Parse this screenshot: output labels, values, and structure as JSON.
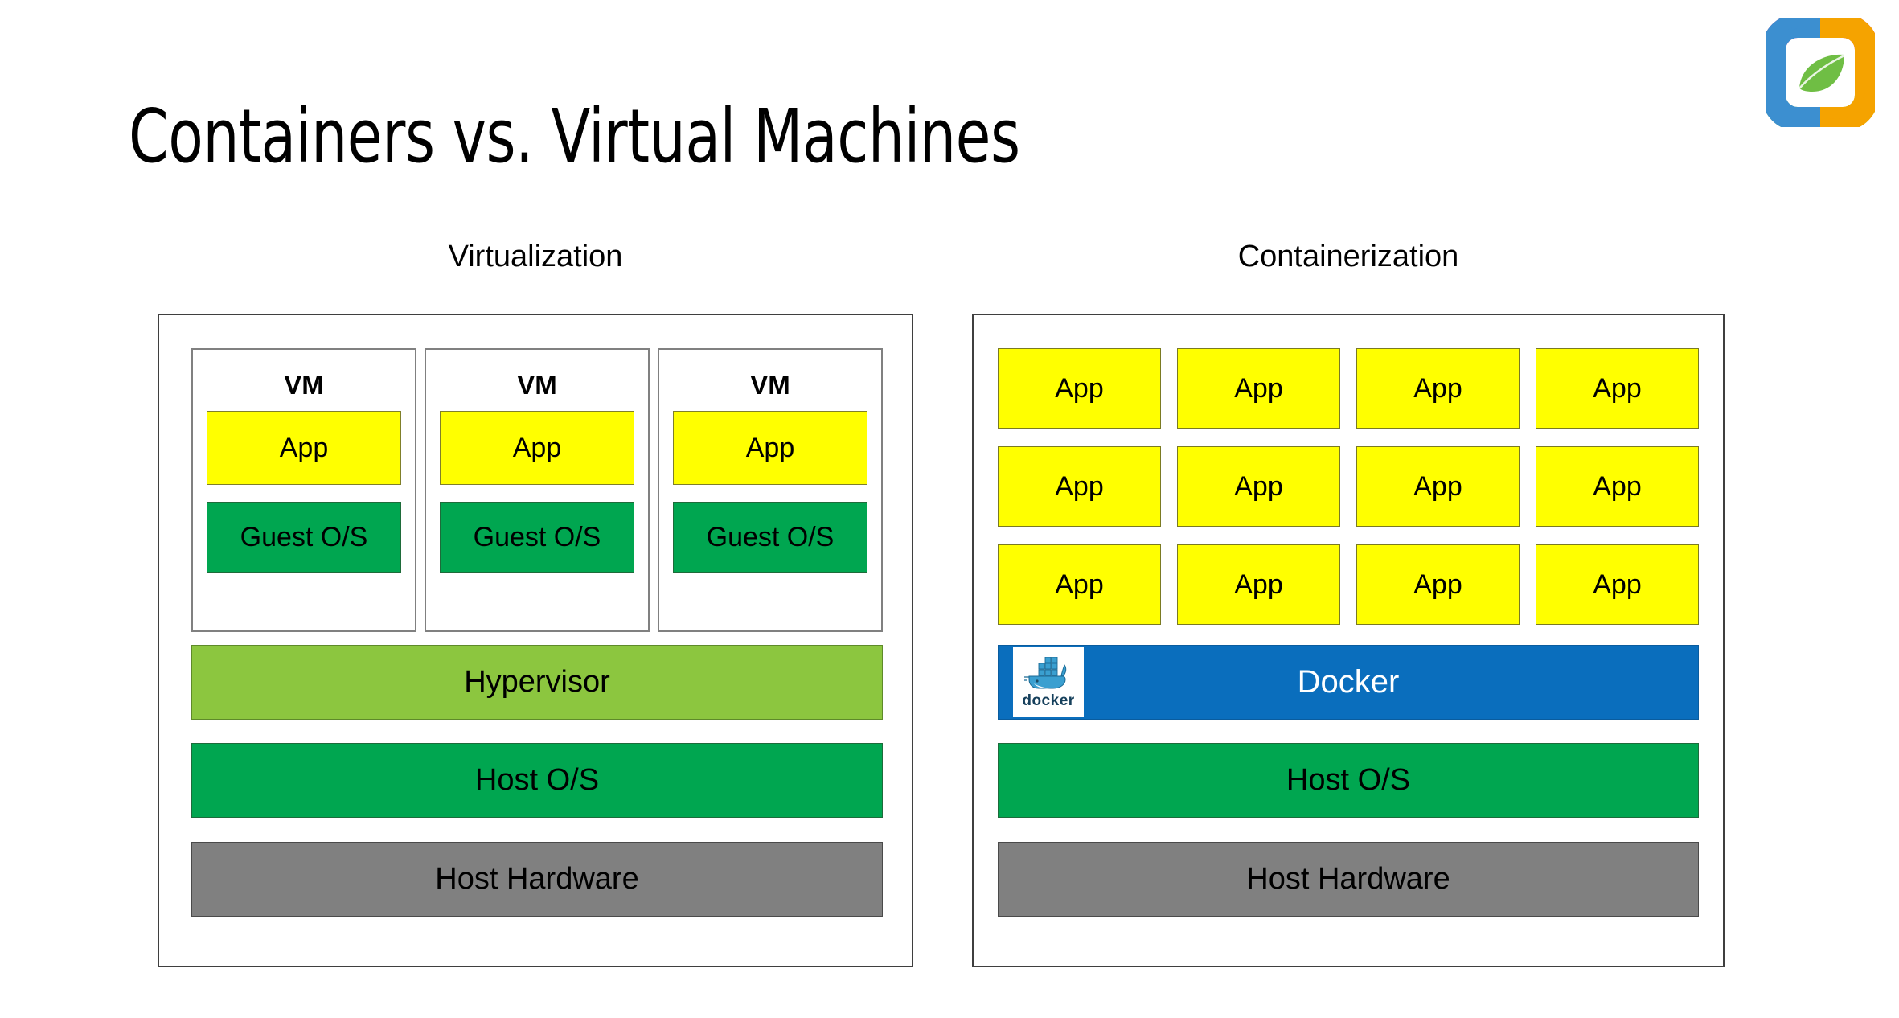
{
  "slide": {
    "title": "Containers vs. Virtual Machines"
  },
  "brand_logo": {
    "icon": "leaf-in-rounded-square-logo",
    "colors": {
      "top": "#E0117B",
      "left": "#3C8FD0",
      "right": "#F5A300",
      "bottom": "#8CC63F",
      "leaf": "#6FBE44"
    }
  },
  "columns": {
    "left": {
      "heading": "Virtualization",
      "vms": [
        {
          "label": "VM",
          "app": "App",
          "guest_os": "Guest O/S"
        },
        {
          "label": "VM",
          "app": "App",
          "guest_os": "Guest O/S"
        },
        {
          "label": "VM",
          "app": "App",
          "guest_os": "Guest O/S"
        }
      ],
      "stack": [
        {
          "label": "Hypervisor",
          "color": "#8CC63F"
        },
        {
          "label": "Host O/S",
          "color": "#00A650"
        },
        {
          "label": "Host Hardware",
          "color": "#808080"
        }
      ]
    },
    "right": {
      "heading": "Containerization",
      "app_grid": {
        "rows": 3,
        "cols": 4,
        "label": "App",
        "cells": [
          [
            "App",
            "App",
            "App",
            "App"
          ],
          [
            "App",
            "App",
            "App",
            "App"
          ],
          [
            "App",
            "App",
            "App",
            "App"
          ]
        ]
      },
      "docker_bar": {
        "label": "Docker",
        "color": "#0A6EBD",
        "logo_icon": "docker-whale-icon",
        "wordmark": "docker"
      },
      "stack": [
        {
          "label": "Host O/S",
          "color": "#00A650"
        },
        {
          "label": "Host Hardware",
          "color": "#808080"
        }
      ]
    }
  },
  "palette": {
    "app_yellow": "#FFFF00",
    "guest_green": "#00A650",
    "hypervisor_green": "#8CC63F",
    "hardware_gray": "#808080",
    "docker_blue": "#0A6EBD"
  }
}
